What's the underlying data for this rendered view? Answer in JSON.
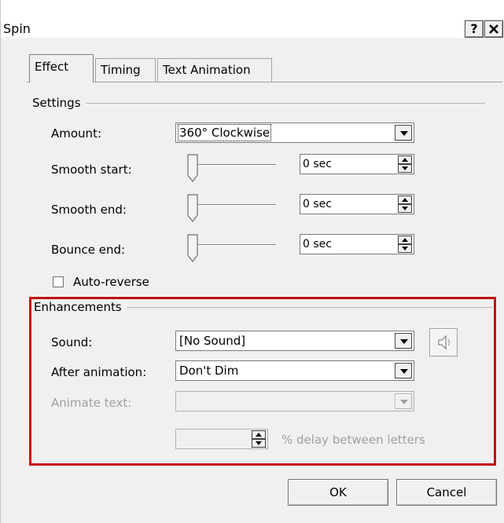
{
  "window": {
    "title": "Spin",
    "help_label": "?",
    "close_label": "✕"
  },
  "tabs": [
    {
      "label": "Effect",
      "active": true
    },
    {
      "label": "Timing",
      "active": false
    },
    {
      "label": "Text Animation",
      "active": false
    }
  ],
  "settings": {
    "title": "Settings",
    "amount": {
      "label": "Amount:",
      "value": "360° Clockwise"
    },
    "smooth_start": {
      "label": "Smooth start:",
      "value": "0 sec"
    },
    "smooth_end": {
      "label": "Smooth end:",
      "value": "0 sec"
    },
    "bounce_end": {
      "label": "Bounce end:",
      "value": "0 sec"
    },
    "auto_reverse": {
      "label": "Auto-reverse",
      "checked": false
    }
  },
  "enhancements": {
    "title": "Enhancements",
    "sound": {
      "label": "Sound:",
      "value": "[No Sound]"
    },
    "after_animation": {
      "label": "After animation:",
      "value": "Don't Dim"
    },
    "animate_text": {
      "label": "Animate text:",
      "value": ""
    },
    "delay": {
      "value": "",
      "label": "% delay between letters"
    }
  },
  "buttons": {
    "ok": "OK",
    "cancel": "Cancel"
  },
  "colors": {
    "highlight": "#c01010",
    "dialog_bg": "#f0f0f0",
    "disabled_text": "#a0a0a0"
  }
}
